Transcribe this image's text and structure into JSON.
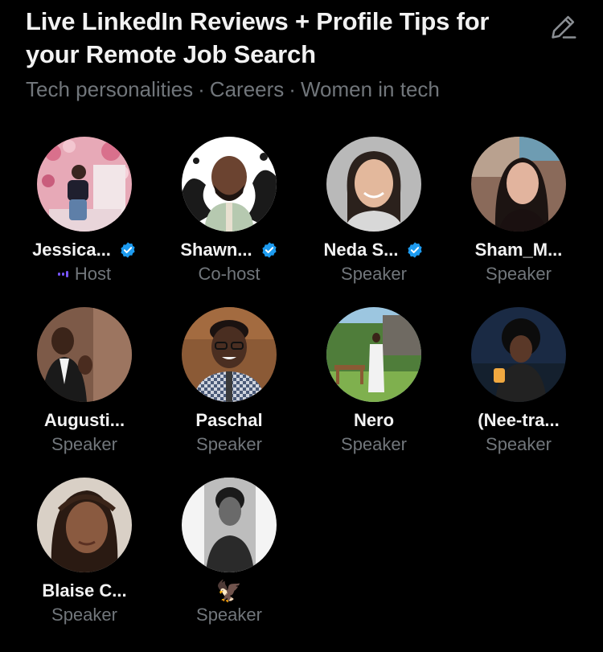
{
  "space": {
    "title": "Live LinkedIn Reviews + Profile Tips for your Remote Job Search",
    "topics": [
      "Tech personalities",
      "Careers",
      "Women in tech"
    ],
    "edit_icon": "pencil-icon"
  },
  "colors": {
    "background": "#000000",
    "text_primary": "#e7e9ea",
    "text_secondary": "#71767b",
    "verified": "#1d9bf0",
    "host_accent": "#7856ff"
  },
  "participants": [
    {
      "name": "Jessica...",
      "role": "Host",
      "verified": true
    },
    {
      "name": "Shawn...",
      "role": "Co-host",
      "verified": true
    },
    {
      "name": "Neda S...",
      "role": "Speaker",
      "verified": true
    },
    {
      "name": "Sham_M...",
      "role": "Speaker",
      "verified": false
    },
    {
      "name": "Augusti...",
      "role": "Speaker",
      "verified": false
    },
    {
      "name": "Paschal",
      "role": "Speaker",
      "verified": false
    },
    {
      "name": "Nero",
      "role": "Speaker",
      "verified": false
    },
    {
      "name": "(Nee-tra...",
      "role": "Speaker",
      "verified": false
    },
    {
      "name": "Blaise C...",
      "role": "Speaker",
      "verified": false
    },
    {
      "name": "🦅",
      "role": "Speaker",
      "verified": false
    }
  ]
}
